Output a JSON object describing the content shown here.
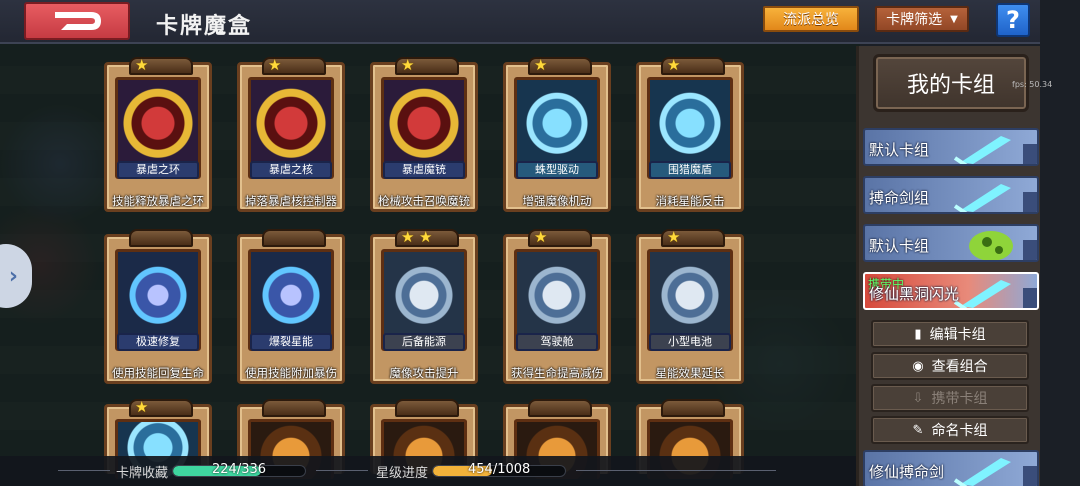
{
  "header": {
    "title": "卡牌魔盒",
    "btn_genre": "流派总览",
    "btn_filter": "卡牌筛选",
    "help": "?"
  },
  "cards": [
    {
      "name": "暴虐之环",
      "desc": "技能释放暴虐之环",
      "stars": 1,
      "style": "gold"
    },
    {
      "name": "暴虐之核",
      "desc": "掉落暴虐核控制器",
      "stars": 1,
      "style": "gold"
    },
    {
      "name": "暴虐魔铳",
      "desc": "枪械攻击召唤魔铳",
      "stars": 1,
      "style": "gold"
    },
    {
      "name": "蛛型驱动",
      "desc": "增强魔像机动",
      "stars": 1,
      "style": "cyan"
    },
    {
      "name": "围猎魔盾",
      "desc": "消耗星能反击",
      "stars": 1,
      "style": "cyan"
    },
    {
      "name": "极速修复",
      "desc": "使用技能回复生命",
      "stars": 0,
      "style": "blue"
    },
    {
      "name": "爆裂星能",
      "desc": "使用技能附加暴伤",
      "stars": 0,
      "style": "blue"
    },
    {
      "name": "后备能源",
      "desc": "魔像攻击提升",
      "stars": 2,
      "style": "steel"
    },
    {
      "name": "驾驶舱",
      "desc": "获得生命提高减伤",
      "stars": 1,
      "style": "steel"
    },
    {
      "name": "小型电池",
      "desc": "星能效果延长",
      "stars": 1,
      "style": "steel"
    }
  ],
  "bottom": {
    "collect_label": "卡牌收藏",
    "collect_value": "224/336",
    "collect_fraction": 0.667,
    "star_label": "星级进度",
    "star_value": "454/1008",
    "star_fraction": 0.45
  },
  "panel": {
    "title": "我的卡组",
    "fps": "fps: 50.34",
    "decks": [
      {
        "name": "默认卡组",
        "carry": ""
      },
      {
        "name": "搏命剑组",
        "carry": ""
      },
      {
        "name": "默认卡组",
        "carry": ""
      },
      {
        "name": "修仙黑洞闪光",
        "carry": "携带中"
      },
      {
        "name": "修仙搏命剑",
        "carry": ""
      }
    ],
    "actions": {
      "edit": "编辑卡组",
      "view": "查看组合",
      "carry": "携带卡组",
      "rename": "命名卡组"
    }
  },
  "colors": {
    "collect_fill": "#3fd6a0",
    "star_fill": "#f2b23a",
    "accent_orange": "#f0a030",
    "help_blue": "#2a78e0"
  }
}
